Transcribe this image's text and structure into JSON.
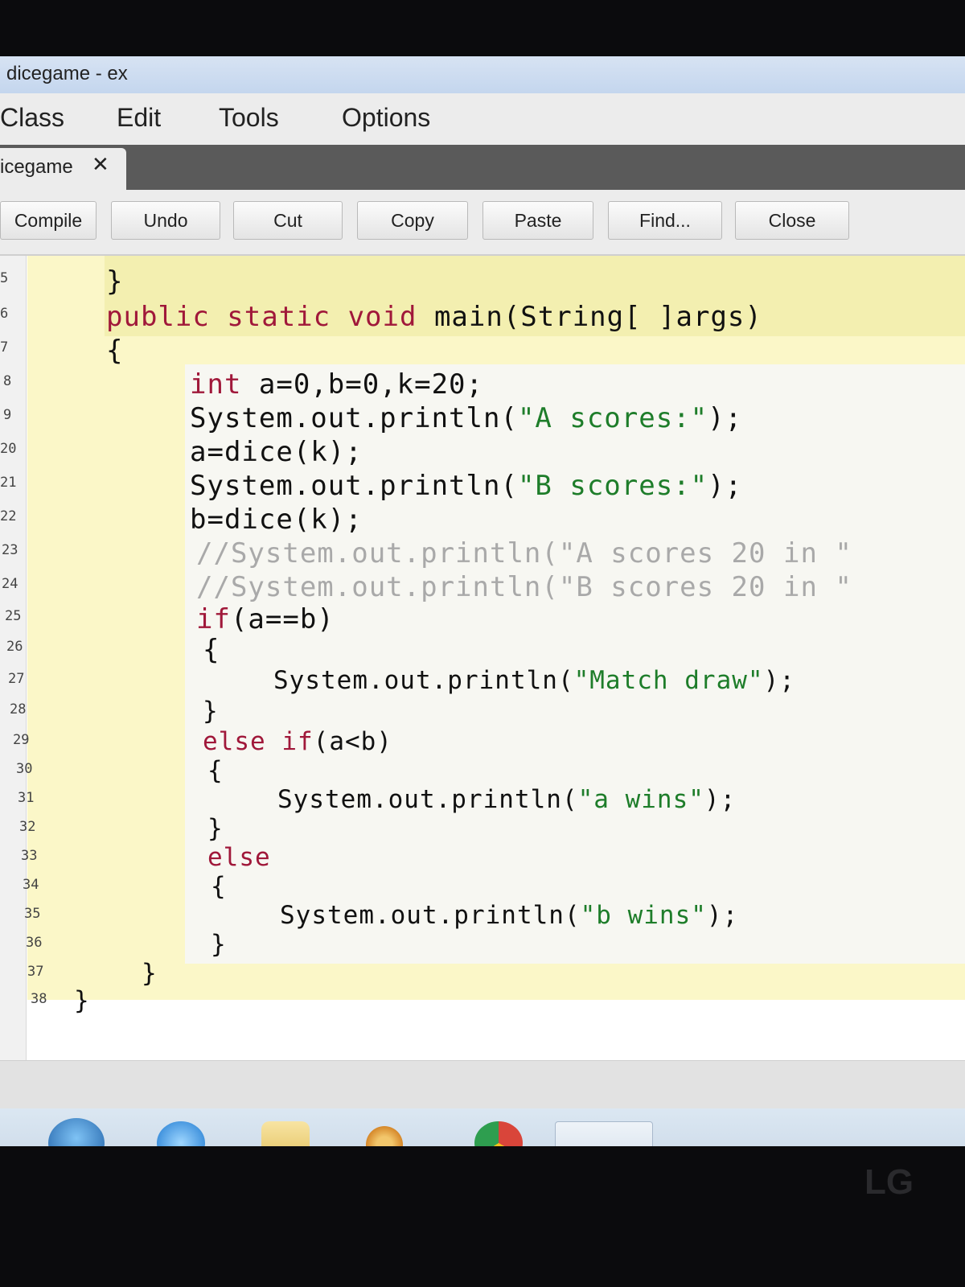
{
  "window": {
    "title": "dicegame - ex"
  },
  "menubar": {
    "items": [
      "Class",
      "Edit",
      "Tools",
      "Options"
    ]
  },
  "tab": {
    "label": "icegame",
    "close_glyph": "✕"
  },
  "toolbar": {
    "buttons": [
      "Compile",
      "Undo",
      "Cut",
      "Copy",
      "Paste",
      "Find...",
      "Close"
    ]
  },
  "editor": {
    "line_numbers": [
      "5",
      "6",
      "7",
      "8",
      "9",
      "20",
      "21",
      "22",
      "23",
      "24",
      "25",
      "26",
      "27",
      "28",
      "29",
      "30",
      "31",
      "32",
      "33",
      "34",
      "35",
      "36",
      "37",
      "38"
    ],
    "lines": [
      [
        {
          "t": "}"
        }
      ],
      [
        {
          "t": "public static ",
          "k": "kw"
        },
        {
          "t": "void",
          "k": "kw"
        },
        {
          "t": " main(String[ ]args)"
        }
      ],
      [
        {
          "t": "{"
        }
      ],
      [
        {
          "t": "int",
          "k": "kw"
        },
        {
          "t": " a=0,b=0,k=20;"
        }
      ],
      [
        {
          "t": "System.out.println("
        },
        {
          "t": "\"A scores:\"",
          "k": "str"
        },
        {
          "t": ");"
        }
      ],
      [
        {
          "t": "a=dice(k);"
        }
      ],
      [
        {
          "t": "System.out.println("
        },
        {
          "t": "\"B scores:\"",
          "k": "str"
        },
        {
          "t": ");"
        }
      ],
      [
        {
          "t": "b=dice(k);"
        }
      ],
      [
        {
          "t": "//System.out.println(\"A scores 20 in \"",
          "k": "cm"
        }
      ],
      [
        {
          "t": "//System.out.println(\"B scores 20 in \"",
          "k": "cm"
        }
      ],
      [
        {
          "t": "if",
          "k": "kw"
        },
        {
          "t": "(a==b)"
        }
      ],
      [
        {
          "t": "{"
        }
      ],
      [
        {
          "t": "System.out.println("
        },
        {
          "t": "\"Match draw\"",
          "k": "str"
        },
        {
          "t": ");"
        }
      ],
      [
        {
          "t": "}"
        }
      ],
      [
        {
          "t": "else if",
          "k": "kw"
        },
        {
          "t": "(a<b)"
        }
      ],
      [
        {
          "t": "{"
        }
      ],
      [
        {
          "t": "System.out.println("
        },
        {
          "t": "\"a wins\"",
          "k": "str"
        },
        {
          "t": ");"
        }
      ],
      [
        {
          "t": "}"
        }
      ],
      [
        {
          "t": "else",
          "k": "kw"
        }
      ],
      [
        {
          "t": "{"
        }
      ],
      [
        {
          "t": "System.out.println("
        },
        {
          "t": "\"b wins\"",
          "k": "str"
        },
        {
          "t": ");"
        }
      ],
      [
        {
          "t": "}"
        }
      ],
      [
        {
          "t": "}"
        }
      ],
      [
        {
          "t": "}"
        }
      ]
    ]
  },
  "monitor": {
    "brand": "LG"
  },
  "colors": {
    "keyword": "#a0183a",
    "string": "#1e7d2a",
    "comment": "#a9a9a9",
    "scope_highlight": "#fbf7c8"
  },
  "taskbar": {
    "icons": [
      "start-orb-icon",
      "internet-explorer-icon",
      "folder-icon",
      "media-player-icon",
      "chrome-icon",
      "bluej-icon"
    ]
  }
}
